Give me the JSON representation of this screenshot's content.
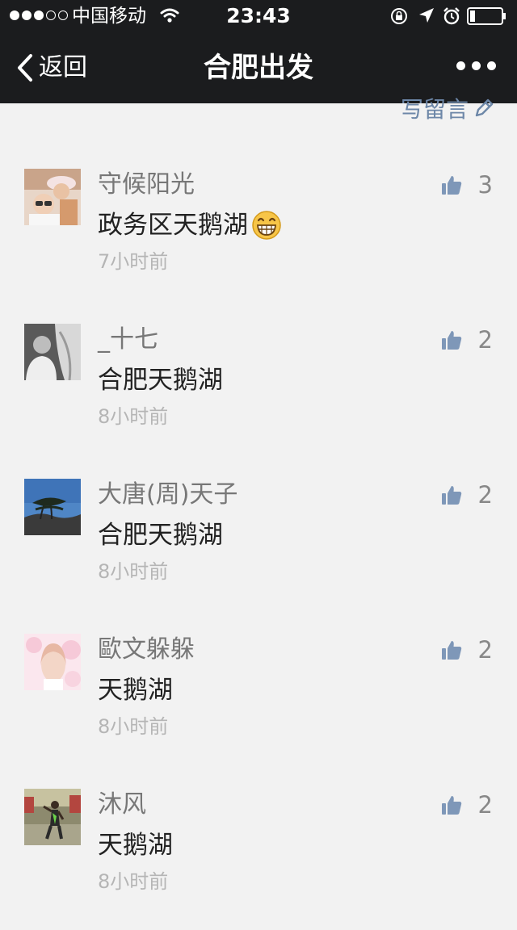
{
  "status_bar": {
    "signal_full": 3,
    "signal_empty": 2,
    "carrier": "中国移动",
    "time": "23:43",
    "battery_level": 0.15
  },
  "nav": {
    "back_label": "返回",
    "title": "合肥出发"
  },
  "write_comment": {
    "label": "写留言"
  },
  "comments": [
    {
      "name": "守候阳光",
      "content": "政务区天鹅湖",
      "emoji": "grin-emoji-icon",
      "time": "7小时前",
      "likes": "3",
      "avatar": "avatar-family-photo"
    },
    {
      "name": "_十七",
      "content": "合肥天鹅湖",
      "time": "8小时前",
      "likes": "2",
      "avatar": "avatar-bw-portrait"
    },
    {
      "name": "大唐(周)天子",
      "content": "合肥天鹅湖",
      "time": "8小时前",
      "likes": "2",
      "avatar": "avatar-pine-sky"
    },
    {
      "name": "歐文躲躲",
      "content": "天鹅湖",
      "time": "8小时前",
      "likes": "2",
      "avatar": "avatar-pink-portrait"
    },
    {
      "name": "沐风",
      "content": "天鹅湖",
      "time": "8小时前",
      "likes": "2",
      "avatar": "avatar-runner-outdoor"
    }
  ],
  "colors": {
    "nav_background": "#1b1c1e",
    "page_background": "#f2f2f2",
    "link_blue": "#6d87a8",
    "thumb_blue": "#7e97b8",
    "name_gray": "#777777",
    "time_gray": "#b5b5b5"
  }
}
